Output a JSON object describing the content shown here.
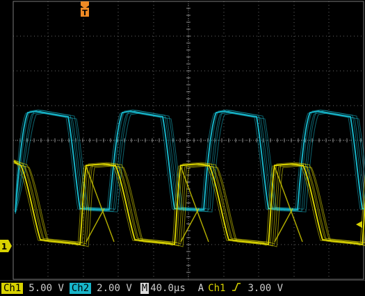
{
  "scope": {
    "trigger_marker": "T",
    "ch1_marker": "1",
    "colors": {
      "ch1": "#d8d200",
      "ch2": "#17b5c9",
      "grid": "#6a6a6a",
      "trig": "#f08a24"
    }
  },
  "status": {
    "ch1_label": "Ch1",
    "ch1_scale": "5.00 V",
    "ch2_label": "Ch2",
    "ch2_scale": "2.00 V",
    "timebase_prefix": "M",
    "timebase": "40.0µs",
    "trigger_mode": "A",
    "trigger_source": "Ch1",
    "trigger_slope_icon": "rising-edge-icon",
    "trigger_level": "3.00 V"
  }
}
